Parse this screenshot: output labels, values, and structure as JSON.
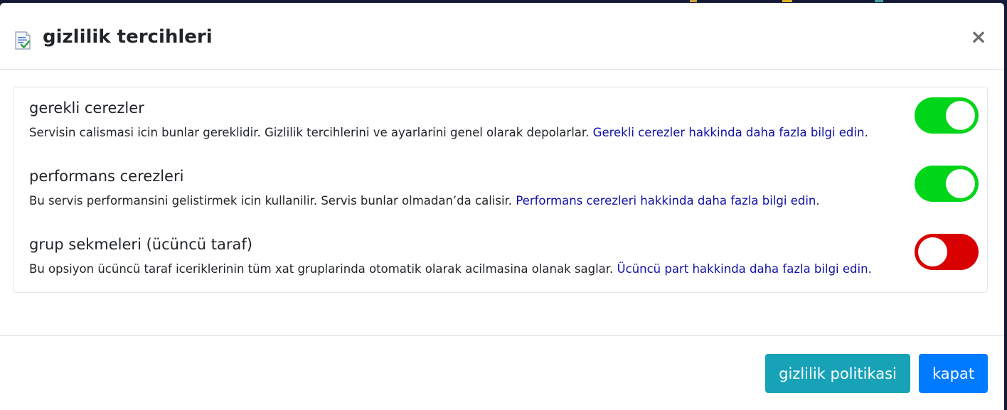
{
  "modal": {
    "title": "gizlilik tercihleri",
    "title_icon": "document-check-icon",
    "close_label": "×"
  },
  "settings": [
    {
      "title": "gerekli cerezler",
      "description": "Servisin calismasi icin bunlar gereklidir. Gizlilik tercihlerini ve ayarlarini genel olarak depolarlar.",
      "link": "Gerekli cerezler hakkinda daha fazla bilgi edin",
      "link_suffix": ".",
      "enabled": true
    },
    {
      "title": "performans cerezleri",
      "description": "Bu servis performansini gelistirmek icin kullanilir. Servis bunlar olmadan’da calisir.",
      "link": "Performans cerezleri hakkinda daha fazla bilgi edin",
      "link_suffix": ".",
      "enabled": true
    },
    {
      "title": "grup sekmeleri (ücüncü taraf)",
      "description": "Bu opsiyon ücüncü taraf iceriklerinin tüm xat gruplarinda otomatik olarak acilmasina olanak saglar.",
      "link": "Ücüncü part hakkinda daha fazla bilgi edin",
      "link_suffix": ".",
      "enabled": false
    }
  ],
  "footer": {
    "policy_label": "gizlilik politikasi",
    "close_label": "kapat"
  },
  "colors": {
    "toggle_on": "#00d619",
    "toggle_off": "#d80000",
    "link": "#1010a8",
    "policy_button": "#17a2b8",
    "close_button": "#007bff"
  }
}
